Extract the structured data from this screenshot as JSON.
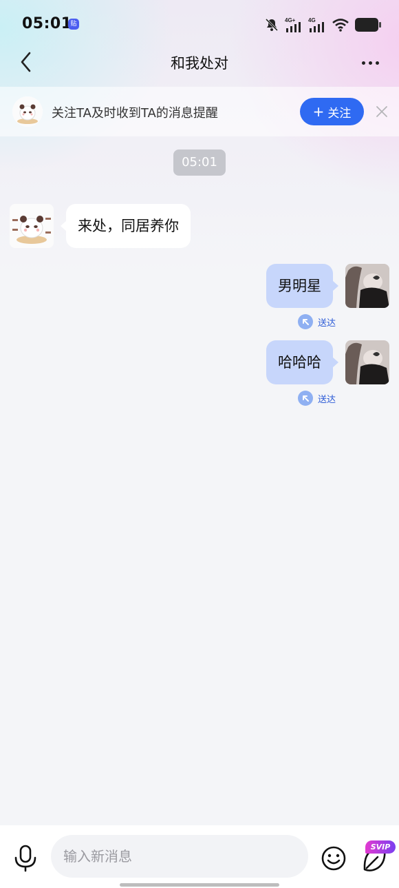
{
  "status_bar": {
    "time": "05:01",
    "app_badge": "贴",
    "signal_1_label": "4G+",
    "signal_2_label": "4G"
  },
  "header": {
    "title": "和我处对"
  },
  "follow_banner": {
    "text": "关注TA及时收到TA的消息提醒",
    "button_label": "关注",
    "button_plus": "+"
  },
  "chat": {
    "timestamp": "05:01",
    "messages": [
      {
        "direction": "in",
        "text": "来处，同居养你"
      },
      {
        "direction": "out",
        "text": "男明星",
        "status": "送达"
      },
      {
        "direction": "out",
        "text": "哈哈哈",
        "status": "送达"
      }
    ]
  },
  "input_bar": {
    "placeholder": "输入新消息",
    "svip_badge": "SVIP"
  },
  "icons": {
    "back": "chevron-left-icon",
    "more": "more-horizontal-icon",
    "close": "close-icon",
    "mic": "microphone-icon",
    "emoji": "smile-icon",
    "plus": "leaf-plus-icon",
    "delivered": "arrow-up-left-icon"
  },
  "colors": {
    "accent": "#2f6af2",
    "outgoing_bubble": "#c7d6fb",
    "delivered_text": "#2b5ad6"
  }
}
